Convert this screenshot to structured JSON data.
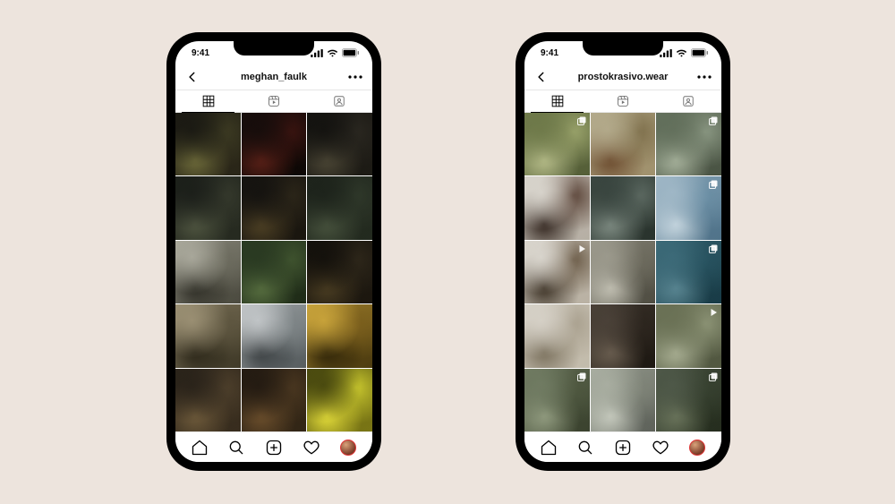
{
  "status": {
    "time": "9:41"
  },
  "icons": {
    "grid": "grid-icon",
    "reels": "reels-icon",
    "tagged": "tagged-icon",
    "home": "home-icon",
    "search": "search-icon",
    "add": "add-post-icon",
    "heart": "activity-icon"
  },
  "phones": [
    {
      "id": "left",
      "username": "meghan_faulk",
      "style_palette": "dark-moody",
      "grid": [
        {
          "c": [
            "#1b1a13",
            "#3c3a22",
            "#6e6b3a",
            "#2a2618"
          ],
          "badge": null
        },
        {
          "c": [
            "#170d0b",
            "#3a1410",
            "#5a2017",
            "#0d0705"
          ],
          "badge": null
        },
        {
          "c": [
            "#141310",
            "#2a2720",
            "#4b4635",
            "#1d1b15"
          ],
          "badge": null
        },
        {
          "c": [
            "#1c1f1a",
            "#35392c",
            "#4f5540",
            "#262a20"
          ],
          "badge": null
        },
        {
          "c": [
            "#151310",
            "#2c2619",
            "#4d4024",
            "#1a160f"
          ],
          "badge": null
        },
        {
          "c": [
            "#1d231b",
            "#2f382a",
            "#47523d",
            "#232a1f"
          ],
          "badge": null
        },
        {
          "c": [
            "#a8a79a",
            "#6c6b5e",
            "#2f2e26",
            "#4b4a3f"
          ],
          "badge": null
        },
        {
          "c": [
            "#2a3a22",
            "#40542f",
            "#586f40",
            "#1f2c18"
          ],
          "badge": null
        },
        {
          "c": [
            "#14110c",
            "#2e271a",
            "#4a3d22",
            "#1c170f"
          ],
          "badge": null
        },
        {
          "c": [
            "#9a8f73",
            "#5d553f",
            "#2c2719",
            "#403a28"
          ],
          "badge": null
        },
        {
          "c": [
            "#c0c4c6",
            "#7d8486",
            "#3c4143",
            "#575d5f"
          ],
          "badge": null
        },
        {
          "c": [
            "#c7a23a",
            "#7a5e1c",
            "#2f2408",
            "#4d3c10"
          ],
          "badge": null
        },
        {
          "c": [
            "#2a231a",
            "#4d3f2b",
            "#6f5b3b",
            "#382d1e"
          ],
          "badge": null
        },
        {
          "c": [
            "#241b12",
            "#4a3720",
            "#6c4f2c",
            "#332616"
          ],
          "badge": null
        },
        {
          "c": [
            "#4a4a0f",
            "#c9c72e",
            "#e5de3a",
            "#7a7615"
          ],
          "badge": null
        }
      ]
    },
    {
      "id": "right",
      "username": "prostokrasivo.wear",
      "style_palette": "earthy-fashion",
      "grid": [
        {
          "c": [
            "#6f7a4a",
            "#9aa36b",
            "#b7bd8a",
            "#555f38"
          ],
          "badge": "carousel"
        },
        {
          "c": [
            "#b2a98a",
            "#7e6f4b",
            "#6b4a2d",
            "#a0916d"
          ],
          "badge": null
        },
        {
          "c": [
            "#63705c",
            "#8a9782",
            "#a8b39d",
            "#4a5444"
          ],
          "badge": "carousel"
        },
        {
          "c": [
            "#d7d3cb",
            "#5a4337",
            "#2f221b",
            "#b6afa4"
          ],
          "badge": null
        },
        {
          "c": [
            "#3a4640",
            "#5d6a62",
            "#7f8c83",
            "#29332d"
          ],
          "badge": null
        },
        {
          "c": [
            "#9fb7c6",
            "#6a8ea4",
            "#c6d6df",
            "#4f7289"
          ],
          "badge": "carousel"
        },
        {
          "c": [
            "#d8d4cc",
            "#6a5a46",
            "#3a2f22",
            "#b9b1a3"
          ],
          "badge": "video"
        },
        {
          "c": [
            "#9b998c",
            "#6c6a5d",
            "#c2c0b3",
            "#4f4d42"
          ],
          "badge": null
        },
        {
          "c": [
            "#3c6a78",
            "#27525f",
            "#5a8692",
            "#183b46"
          ],
          "badge": "carousel"
        },
        {
          "c": [
            "#d5d0c6",
            "#a89f8d",
            "#7a705c",
            "#c2bbab"
          ],
          "badge": null
        },
        {
          "c": [
            "#4a4138",
            "#2c251e",
            "#6a5e50",
            "#1d1812"
          ],
          "badge": null
        },
        {
          "c": [
            "#6b7256",
            "#8d9476",
            "#aab094",
            "#515740"
          ],
          "badge": "video"
        },
        {
          "c": [
            "#707b62",
            "#4e573f",
            "#929c80",
            "#3a422e"
          ],
          "badge": "carousel"
        },
        {
          "c": [
            "#a8ada0",
            "#7e8377",
            "#c6cabe",
            "#5e625a"
          ],
          "badge": null
        },
        {
          "c": [
            "#4e5848",
            "#36402f",
            "#6a745b",
            "#252d1e"
          ],
          "badge": "carousel"
        }
      ]
    }
  ]
}
